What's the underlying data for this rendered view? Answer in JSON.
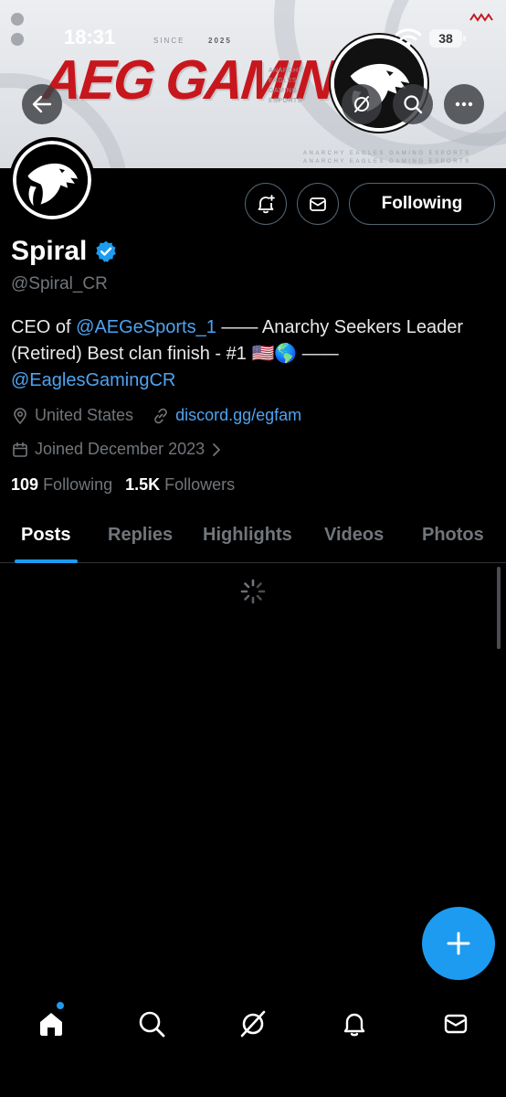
{
  "status_bar": {
    "time": "18:31",
    "battery": "38"
  },
  "banner": {
    "title": "AEG GAMING",
    "since_label": "SINCE",
    "since_value": "2025",
    "list": [
      "ANARCHY",
      "EAGLES",
      "GAMING",
      "ESPORTS"
    ],
    "footer_lines": [
      "ANARCHY EAGLES GAMING ESPORTS",
      "ANARCHY EAGLES GAMING ESPORTS"
    ],
    "accent_color": "#c8161d"
  },
  "header_buttons": {
    "back": "arrow-left-icon",
    "grok": "grok-icon",
    "search": "search-icon",
    "more": "more-icon"
  },
  "profile": {
    "name": "Spiral",
    "verified": true,
    "handle": "@Spiral_CR",
    "bio_prefix": "CEO of ",
    "bio_mention_1": "@AEGeSports_1",
    "bio_middle": " —— Anarchy Seekers Leader (Retired) Best clan finish - #1 🇺🇸🌎 —— ",
    "bio_mention_2": "@EaglesGamingCR",
    "location": "United States",
    "website": "discord.gg/egfam",
    "joined": "Joined December 2023",
    "following_count": "109",
    "following_label": "Following",
    "followers_count": "1.5K",
    "followers_label": "Followers"
  },
  "actions": {
    "follow_label": "Following",
    "notify_icon": "bell-plus-icon",
    "message_icon": "mail-icon"
  },
  "tabs": [
    {
      "label": "Posts",
      "active": true
    },
    {
      "label": "Replies",
      "active": false
    },
    {
      "label": "Highlights",
      "active": false
    },
    {
      "label": "Videos",
      "active": false
    },
    {
      "label": "Photos",
      "active": false
    }
  ],
  "colors": {
    "accent": "#1d9bf0",
    "link": "#4ea3f1",
    "muted": "#71767b"
  },
  "bottom_nav": [
    "home-icon",
    "search-icon",
    "grok-icon",
    "bell-icon",
    "mail-icon"
  ]
}
